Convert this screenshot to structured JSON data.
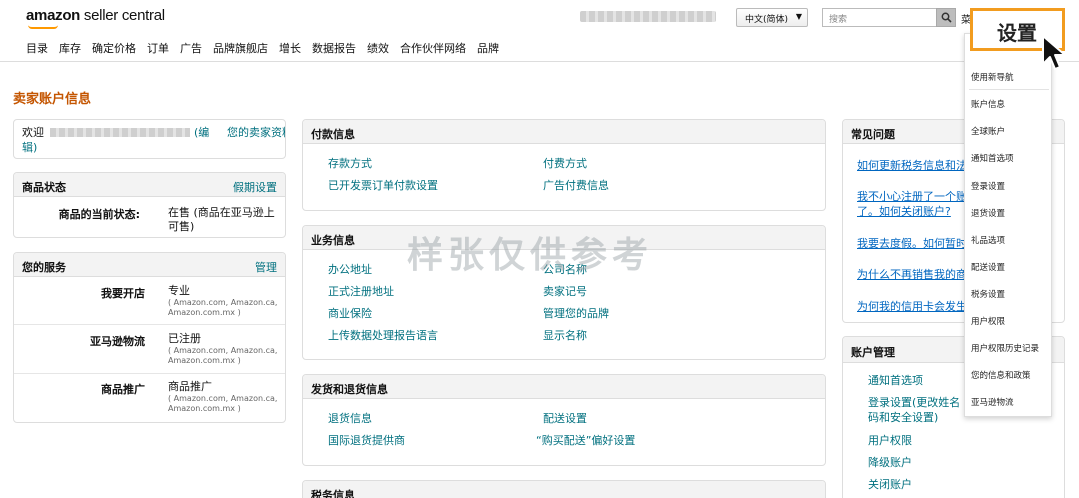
{
  "header": {
    "logo_bold": "amazon",
    "logo_rest": " seller central",
    "language": "中文(简体)",
    "search_placeholder": "搜索",
    "menu_cut": "菜"
  },
  "nav": [
    "目录",
    "库存",
    "确定价格",
    "订单",
    "广告",
    "品牌旗舰店",
    "增长",
    "数据报告",
    "绩效",
    "合作伙伴网络",
    "品牌"
  ],
  "page_title": "卖家账户信息",
  "welcome": {
    "prefix": "欢迎",
    "edit_open": "(编",
    "edit_close": "辑)",
    "profile_link": "您的卖家资料"
  },
  "product_status": {
    "title": "商品状态",
    "link": "假期设置",
    "label": "商品的当前状态:",
    "value_line1": "在售 (商品在亚马逊上",
    "value_line2": "可售)"
  },
  "services": {
    "title": "您的服务",
    "link": "管理",
    "rows": [
      {
        "label": "我要开店",
        "value": "专业",
        "detail1": "( Amazon.com, Amazon.ca,",
        "detail2": "Amazon.com.mx )"
      },
      {
        "label": "亚马逊物流",
        "value": "已注册",
        "detail1": "( Amazon.com, Amazon.ca,",
        "detail2": "Amazon.com.mx )"
      },
      {
        "label": "商品推广",
        "value": "商品推广",
        "detail1": "( Amazon.com, Amazon.ca,",
        "detail2": "Amazon.com.mx )"
      }
    ]
  },
  "payment": {
    "title": "付款信息",
    "links": [
      "存款方式",
      "付费方式",
      "已开发票订单付款设置",
      "广告付费信息"
    ]
  },
  "business": {
    "title": "业务信息",
    "links": [
      "办公地址",
      "公司名称",
      "正式注册地址",
      "卖家记号",
      "商业保险",
      "管理您的品牌",
      "上传数据处理报告语言",
      "显示名称"
    ]
  },
  "shipping": {
    "title": "发货和退货信息",
    "links": [
      "退货信息",
      "配送设置",
      "国际退货提供商",
      "“购买配送”偏好设置"
    ]
  },
  "tax": {
    "title": "税务信息"
  },
  "faq": {
    "title": "常见问题",
    "links": [
      "如何更新税务信息和法定名称",
      "我不小心注册了一个账户或者",
      "了。如何关闭账户?",
      "我要去度假。如何暂时停售商",
      "为什么不再销售我的商品?",
      "为何我的信用卡会发生错误或"
    ]
  },
  "account_mgmt": {
    "title": "账户管理",
    "links": [
      "通知首选项",
      "登录设置(更改姓名",
      "码和安全设置)",
      "用户权限",
      "降级账户",
      "关闭账户"
    ]
  },
  "settings_menu": {
    "callout": "设置",
    "items": [
      "使用新导航",
      "账户信息",
      "全球账户",
      "通知首选项",
      "登录设置",
      "退货设置",
      "礼品选项",
      "配送设置",
      "税务设置",
      "用户权限",
      "用户权限历史记录",
      "您的信息和政策",
      "亚马逊物流"
    ]
  },
  "watermark": "样张仅供参考",
  "colors": {
    "title_orange": "#c45500",
    "link_teal": "#00707f",
    "callout_orange": "#f29c1f"
  }
}
